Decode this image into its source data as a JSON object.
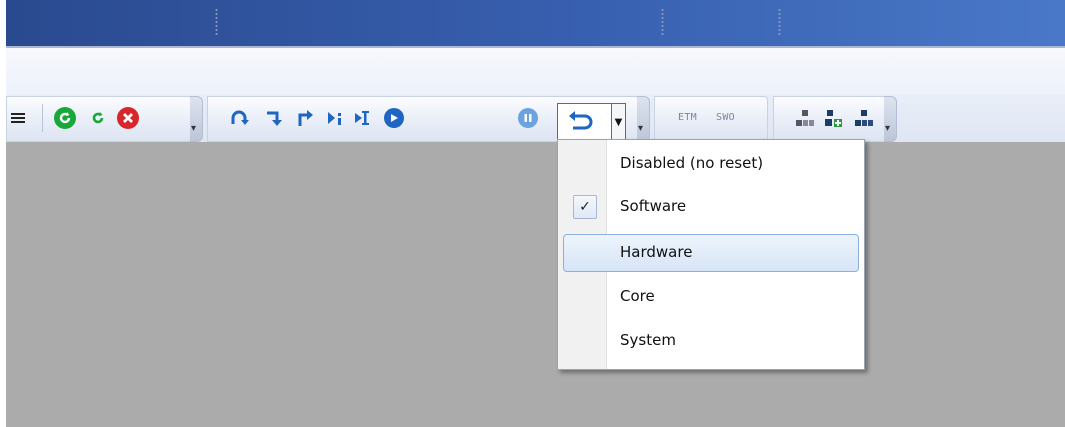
{
  "toolbar": {
    "ctrl_buttons": [
      {
        "icon": "rebuild-icon",
        "glyph": "⟳"
      },
      {
        "icon": "reset-icon",
        "glyph": "⟳"
      },
      {
        "icon": "stop-icon",
        "glyph": "✕"
      }
    ],
    "debug_buttons": [
      {
        "icon": "step-over-icon"
      },
      {
        "icon": "step-into-icon"
      },
      {
        "icon": "step-out-icon"
      },
      {
        "icon": "run-to-cursor-icon"
      },
      {
        "icon": "show-next-statement-icon"
      },
      {
        "icon": "run-icon"
      },
      {
        "icon": "pause-icon"
      }
    ],
    "trace_labels": [
      "ETM",
      "SWO"
    ]
  },
  "reset_dropdown": {
    "items": [
      {
        "label": "Disabled (no reset)",
        "checked": false,
        "highlighted": false
      },
      {
        "label": "Software",
        "checked": true,
        "highlighted": false
      },
      {
        "label": "Hardware",
        "checked": false,
        "highlighted": true
      },
      {
        "label": "Core",
        "checked": false,
        "highlighted": false
      },
      {
        "label": "System",
        "checked": false,
        "highlighted": false
      }
    ]
  },
  "colors": {
    "accent_green": "#18a83a",
    "accent_red": "#d9262b",
    "accent_blue": "#1f66c2",
    "workspace": "#ababab"
  }
}
